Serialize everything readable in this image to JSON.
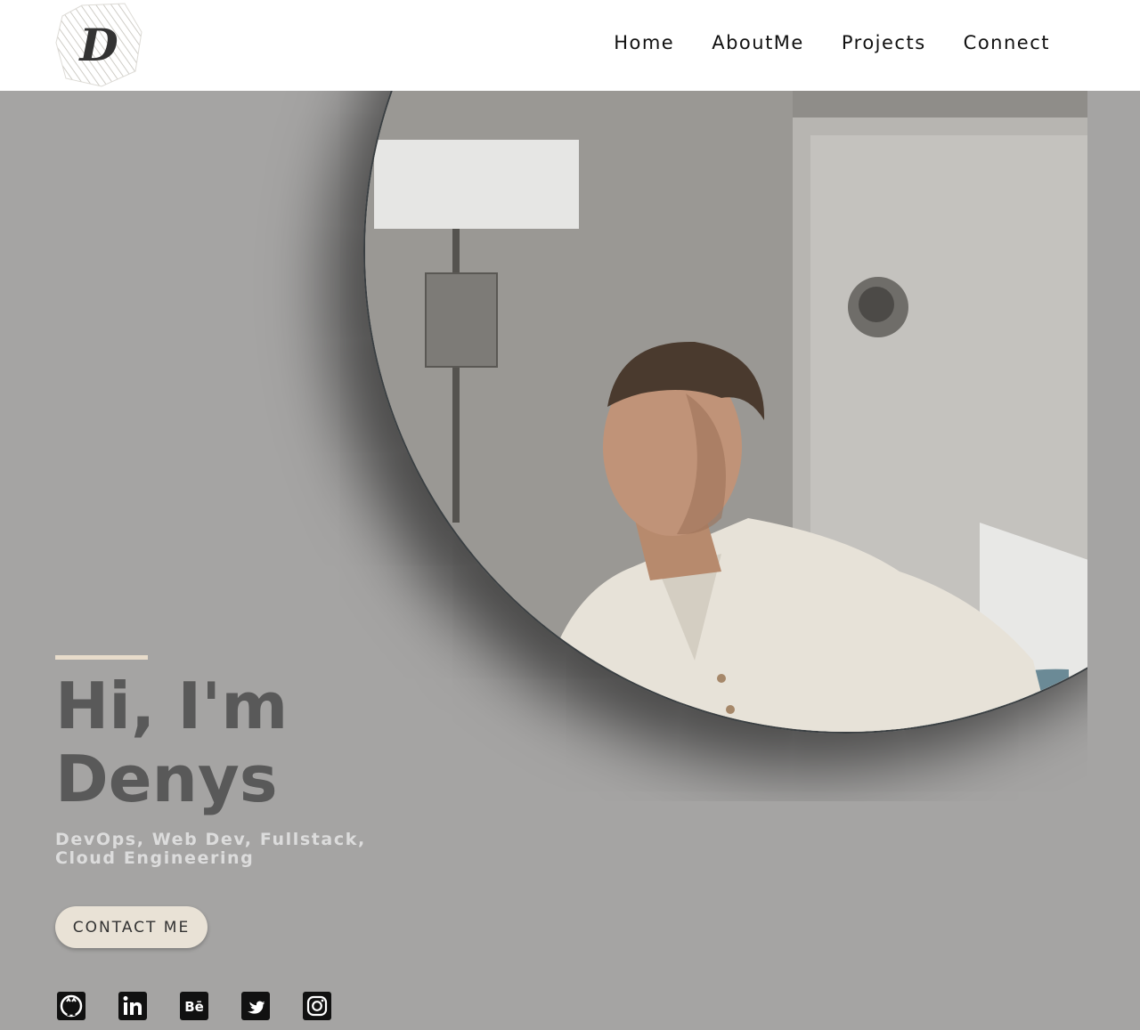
{
  "header": {
    "logo_letter": "D",
    "nav": [
      {
        "label": "Home"
      },
      {
        "label": "AboutMe"
      },
      {
        "label": "Projects"
      },
      {
        "label": "Connect"
      }
    ]
  },
  "hero": {
    "title_line1": "Hi, I'm",
    "title_line2": "Denys",
    "subtitle": "DevOps, Web Dev, Fullstack, Cloud Engineering",
    "contact_button": "CONTACT ME"
  },
  "socials": [
    {
      "icon": "github-icon"
    },
    {
      "icon": "linkedin-icon"
    },
    {
      "icon": "behance-icon",
      "label": "Bē"
    },
    {
      "icon": "twitter-icon"
    },
    {
      "icon": "instagram-icon"
    }
  ],
  "colors": {
    "background": "#a5a4a3",
    "accent": "#e8dccb",
    "button": "#e9e2d6",
    "title": "#595959"
  }
}
